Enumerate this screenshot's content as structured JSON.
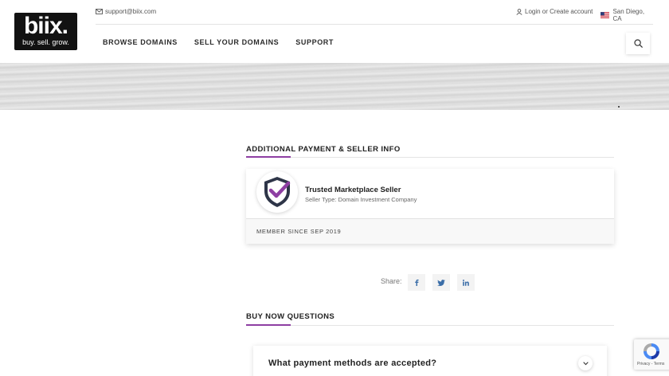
{
  "header": {
    "logo": {
      "brand": "biix.",
      "tagline": "buy. sell. grow."
    },
    "email": "support@biix.com",
    "account": "Login or Create account",
    "location": "San Diego, CA",
    "nav": [
      {
        "label": "BROWSE DOMAINS"
      },
      {
        "label": "SELL YOUR DOMAINS"
      },
      {
        "label": "SUPPORT"
      }
    ]
  },
  "seller_section": {
    "title": "ADDITIONAL PAYMENT & SELLER INFO",
    "seller_name": "Trusted Marketplace Seller",
    "seller_type": "Seller Type: Domain Investment Company",
    "member_since": "MEMBER SINCE SEP 2019"
  },
  "share": {
    "label": "Share:",
    "networks": [
      "facebook-icon",
      "twitter-icon",
      "linkedin-icon"
    ]
  },
  "faq_section": {
    "title": "BUY NOW QUESTIONS",
    "items": [
      {
        "question": "What payment methods are accepted?"
      }
    ]
  },
  "recaptcha": {
    "links": "Privacy - Terms"
  },
  "colors": {
    "accent": "#8e3fa3",
    "shield_dark": "#2e3548",
    "share_icon": "#3b6ea8"
  }
}
